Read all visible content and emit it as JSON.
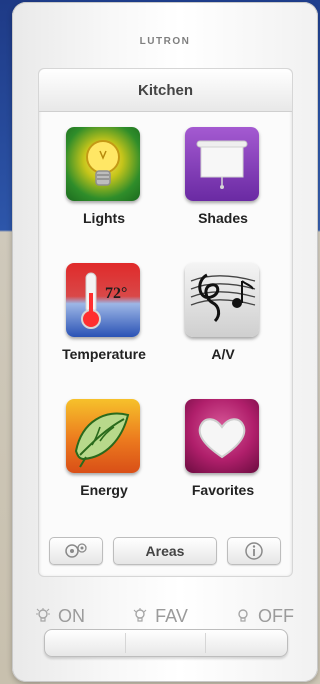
{
  "device": {
    "brand": "LUTRON"
  },
  "screen": {
    "title": "Kitchen",
    "tiles": [
      {
        "label": "Lights",
        "icon": "lightbulb-icon"
      },
      {
        "label": "Shades",
        "icon": "shades-icon"
      },
      {
        "label": "Temperature",
        "icon": "thermometer-icon",
        "temp_readout": "72°"
      },
      {
        "label": "A/V",
        "icon": "music-notes-icon"
      },
      {
        "label": "Energy",
        "icon": "leaf-icon"
      },
      {
        "label": "Favorites",
        "icon": "heart-icon"
      }
    ],
    "bottom_bar": {
      "left_icon": "settings-cluster-icon",
      "center_label": "Areas",
      "right_icon": "info-icon"
    }
  },
  "keypad": {
    "keys": [
      {
        "label": "ON",
        "icon": "bulb-on-icon"
      },
      {
        "label": "FAV",
        "icon": "bulb-favorite-icon"
      },
      {
        "label": "OFF",
        "icon": "bulb-off-icon"
      }
    ]
  }
}
